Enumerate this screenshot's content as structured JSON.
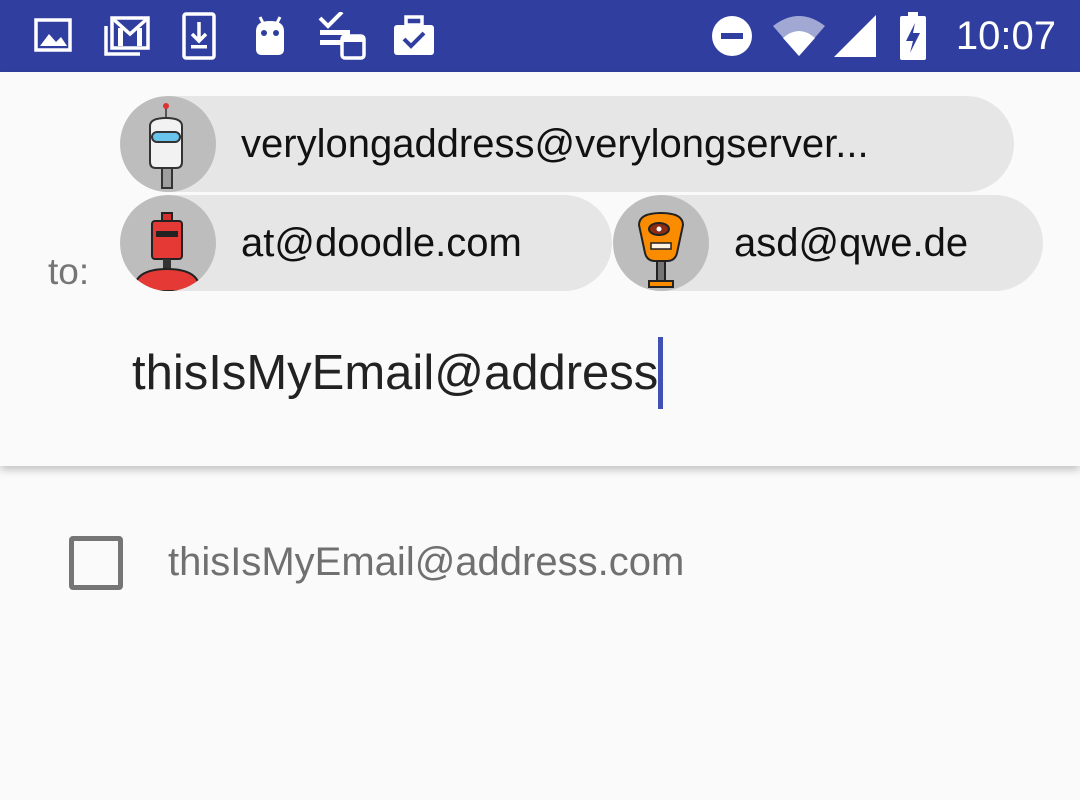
{
  "status_bar": {
    "time": "10:07",
    "background_color": "#303f9f",
    "left_icons": [
      "image-icon",
      "gmail-icon",
      "download-icon",
      "android-icon",
      "tasks-icon",
      "work-icon"
    ],
    "right_icons": [
      "do-not-disturb-icon",
      "wifi-icon",
      "cell-signal-icon",
      "battery-charging-icon"
    ]
  },
  "recipients": {
    "to_label": "to:",
    "chips": [
      {
        "label": "verylongaddress@verylongserver...",
        "avatar": "white-robot-avatar"
      },
      {
        "label": "at@doodle.com",
        "avatar": "red-robot-avatar"
      },
      {
        "label": "asd@qwe.de",
        "avatar": "orange-robot-avatar"
      }
    ],
    "input": {
      "value": "thisIsMyEmail@address"
    },
    "accent_color": "#3f51b5",
    "chip_color": "#e6e6e6"
  },
  "suggestions": [
    {
      "label": "thisIsMyEmail@address.com",
      "checked": false
    }
  ]
}
